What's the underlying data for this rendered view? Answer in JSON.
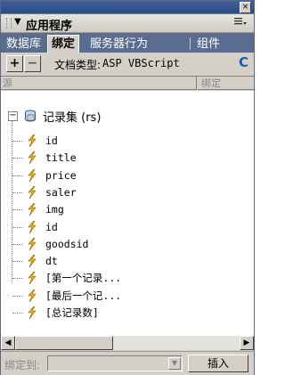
{
  "window": {
    "close_glyph": "×"
  },
  "panel": {
    "title": "应用程序",
    "collapse_glyph": "▼",
    "menu_icon": "menu-options-icon"
  },
  "tabs": [
    {
      "label": "数据库",
      "active": false
    },
    {
      "label": "绑定",
      "active": true
    },
    {
      "label": "服务器行为",
      "active": false
    },
    {
      "label": "组件",
      "active": false
    }
  ],
  "toolbar": {
    "add_glyph": "+",
    "remove_glyph": "−",
    "doc_type_label": "文档类型:",
    "doc_type_value": "ASP VBScript",
    "refresh_glyph": "C"
  },
  "columns": {
    "source": "源",
    "binding": "绑定"
  },
  "tree": {
    "expander_glyph": "−",
    "recordset_label": "记录集 (rs)",
    "fields": [
      "id",
      "title",
      "price",
      "saler",
      "img",
      "id",
      "goodsid",
      "dt",
      "[第一个记录...",
      "[最后一个记...",
      "[总记录数]"
    ]
  },
  "scrollbar": {
    "left_glyph": "◀",
    "right_glyph": "▶"
  },
  "bottom": {
    "bind_to_label": "绑定到:",
    "bind_to_value": "",
    "dropdown_glyph": "▼",
    "insert_button": "插入"
  },
  "colors": {
    "titlebar": "#2d4d84",
    "tabbar": "#5b6d8e",
    "panel_bg": "#d4d0c8",
    "bolt": "#f2b418"
  }
}
